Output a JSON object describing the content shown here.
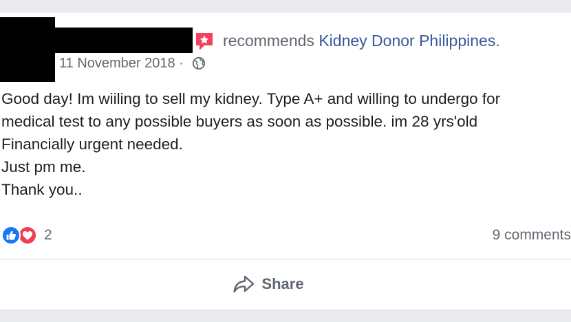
{
  "post": {
    "verb": "recommends",
    "page_name": "Kidney Donor Philippines",
    "period": ".",
    "date": "11 November 2018",
    "dot_separator": " · ",
    "privacy_icon": "globe-icon",
    "recommend_icon": "recommend-star-icon",
    "body_lines": [
      "Good day! Im wiiling to sell my kidney. Type A+ and willing to undergo for",
      "medical test to any possible buyers as soon as possible. im 28 yrs'old",
      "Financially urgent needed.",
      "Just pm me.",
      "Thank you.."
    ]
  },
  "engagement": {
    "reaction_icons": [
      "like-icon",
      "love-icon"
    ],
    "reaction_count": "2",
    "comments_label": "9 comments"
  },
  "actions": {
    "share_label": "Share",
    "share_icon": "share-arrow-icon"
  },
  "colors": {
    "link": "#385898",
    "like": "#1877f2",
    "love": "#f33e58",
    "recommend": "#f3425f"
  }
}
